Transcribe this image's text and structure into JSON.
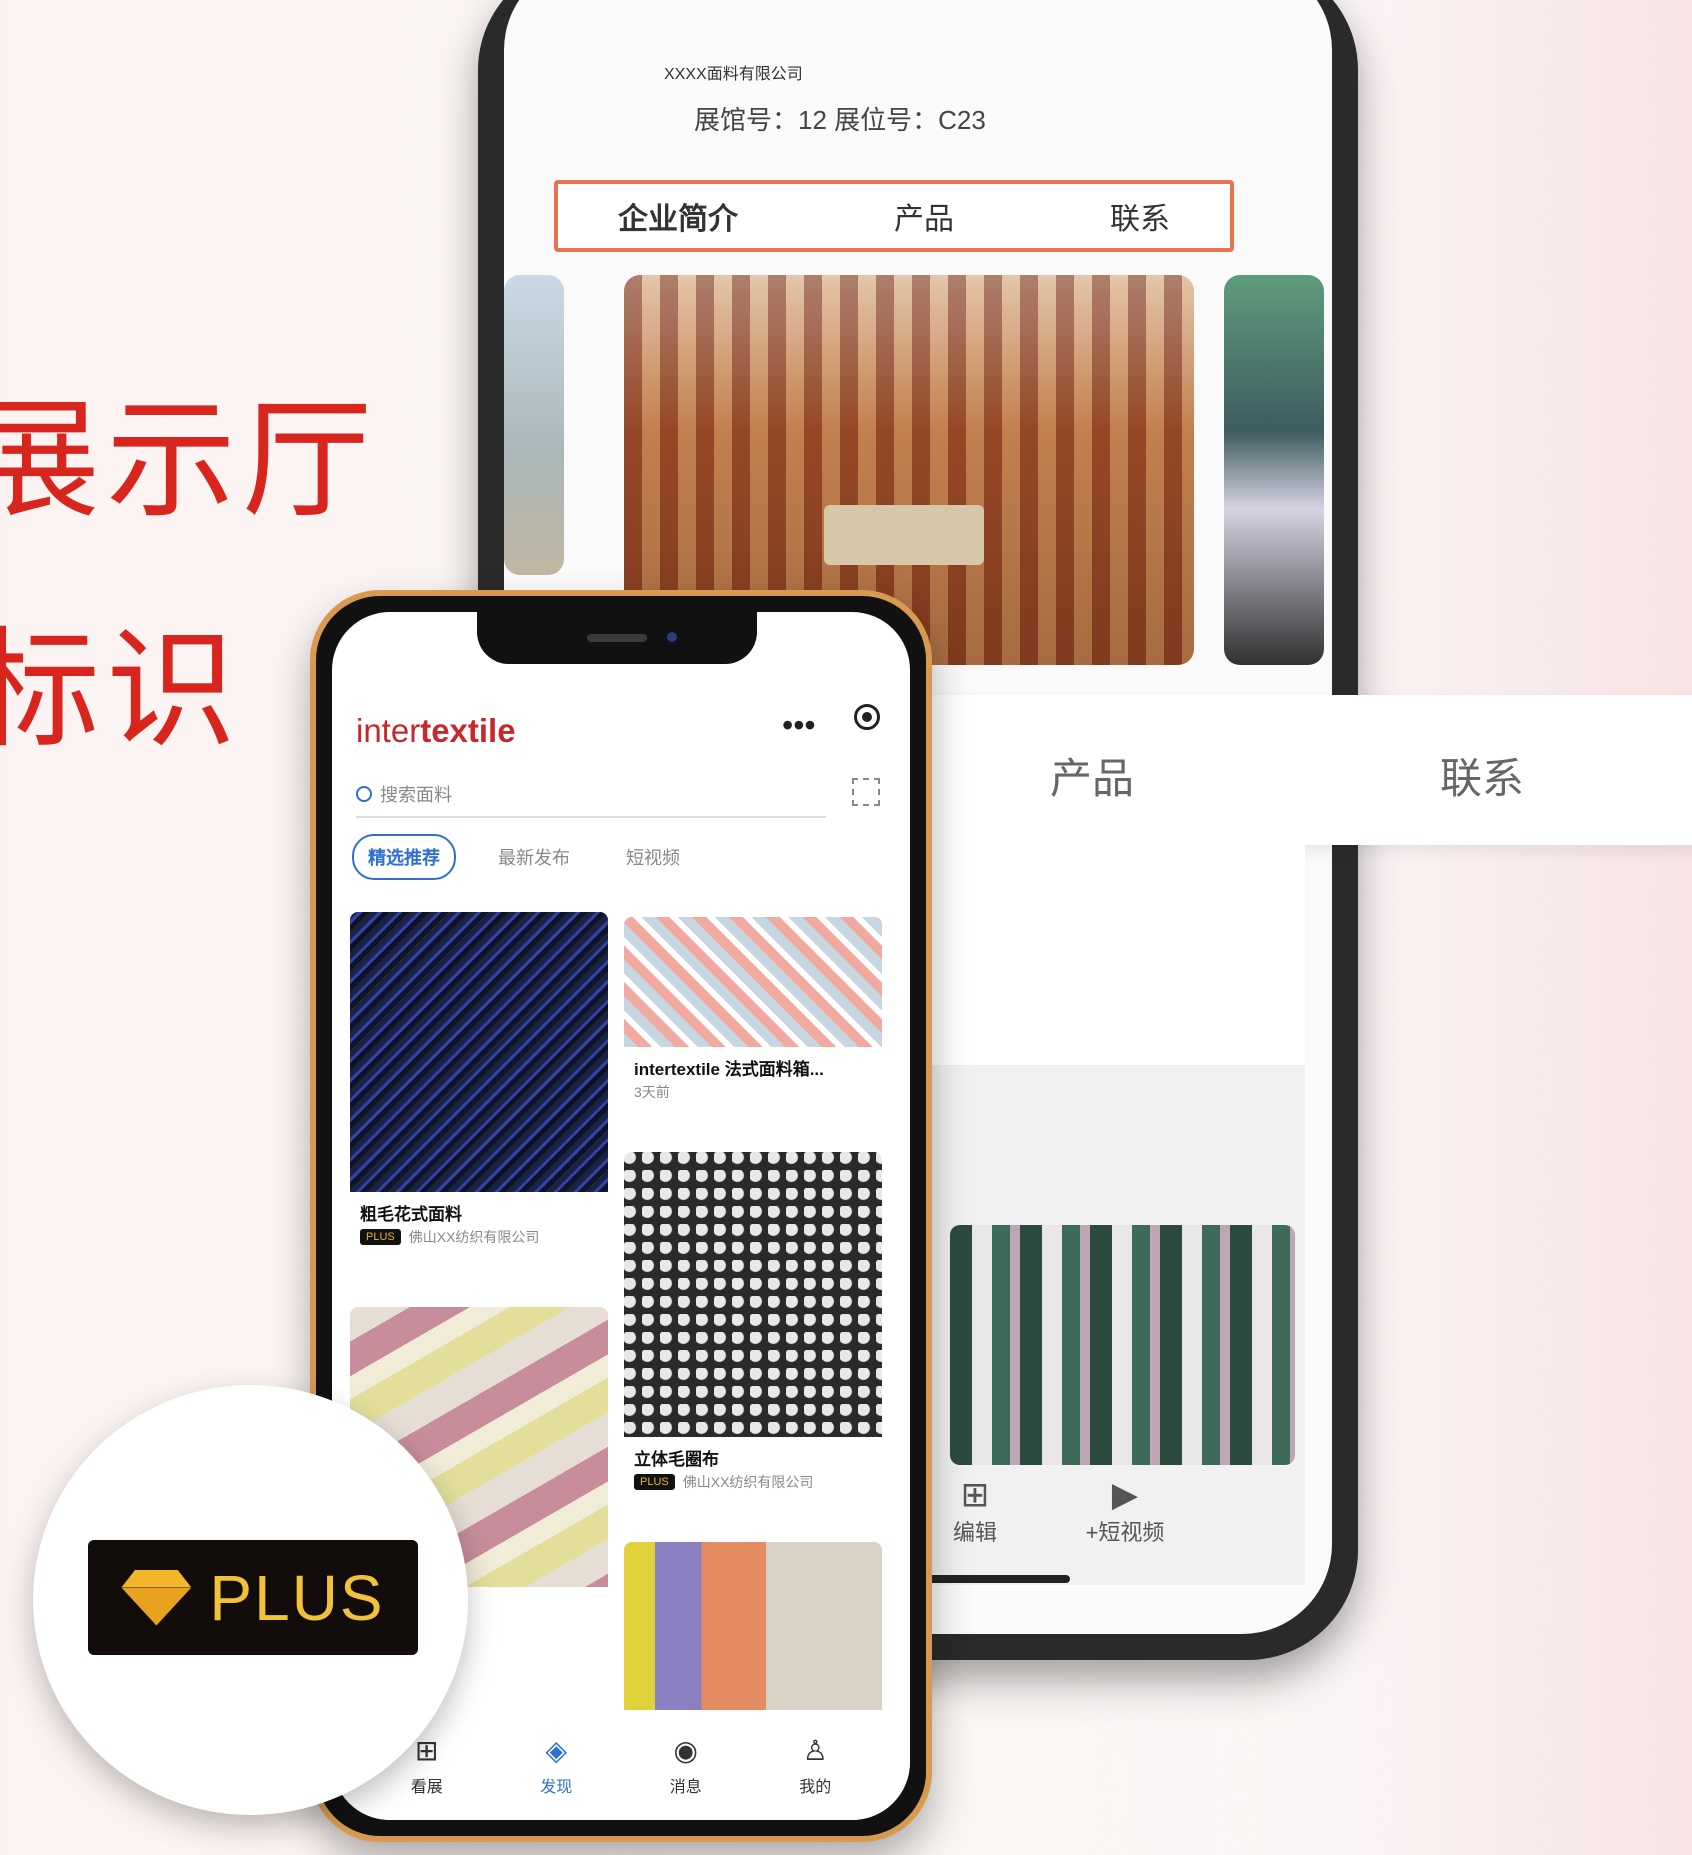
{
  "headline": {
    "line1": "展示厅",
    "line2": "标识"
  },
  "back_phone": {
    "company": "XXXX面料有限公司",
    "booth": "展馆号：12  展位号：C23",
    "tabs": [
      "企业简介",
      "产品",
      "联系"
    ],
    "strip_tabs": [
      "产品",
      "联系"
    ],
    "bottom_nav": [
      {
        "icon": "grid-icon",
        "label": "编辑"
      },
      {
        "icon": "video-icon",
        "label": "+短视频"
      }
    ]
  },
  "front_phone": {
    "logo_light": "inter",
    "logo_bold": "textile",
    "search_placeholder": "搜索面料",
    "chips": [
      "精选推荐",
      "最新发布",
      "短视频"
    ],
    "cards": [
      {
        "title": "粗毛花式面料",
        "badge": "PLUS",
        "company": "佛山XX纺织有限公司"
      },
      {
        "title": "intertextile 法式面料箱...",
        "sub": "3天前"
      },
      {
        "title": "",
        "badge": "",
        "company": ""
      },
      {
        "title": "立体毛圈布",
        "badge": "PLUS",
        "company": "佛山XX纺织有限公司"
      },
      {
        "title": ""
      }
    ],
    "bottom_nav": [
      {
        "icon": "grid-icon",
        "label": "看展"
      },
      {
        "icon": "layers-icon",
        "label": "发现"
      },
      {
        "icon": "chat-icon",
        "label": "消息"
      },
      {
        "icon": "person-icon",
        "label": "我的"
      }
    ]
  },
  "plus_badge": {
    "text": "PLUS"
  },
  "colors": {
    "accent_red": "#d8261f",
    "brand_blue": "#2f6fd1",
    "gold": "#f0c23a"
  }
}
